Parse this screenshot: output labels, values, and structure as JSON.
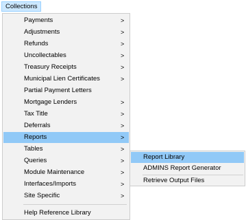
{
  "menubar": {
    "title": "Collections"
  },
  "menu": {
    "items": [
      {
        "label": "Payments",
        "has_submenu": true
      },
      {
        "label": "Adjustments",
        "has_submenu": true
      },
      {
        "label": "Refunds",
        "has_submenu": true
      },
      {
        "label": "Uncollectables",
        "has_submenu": true
      },
      {
        "label": "Treasury Receipts",
        "has_submenu": true
      },
      {
        "label": "Municipal Lien Certificates",
        "has_submenu": true
      },
      {
        "label": "Partial Payment Letters",
        "has_submenu": false
      },
      {
        "label": "Mortgage Lenders",
        "has_submenu": true
      },
      {
        "label": "Tax Title",
        "has_submenu": true
      },
      {
        "label": "Deferrals",
        "has_submenu": true
      },
      {
        "label": "Reports",
        "has_submenu": true,
        "selected": true
      },
      {
        "label": "Tables",
        "has_submenu": true
      },
      {
        "label": "Queries",
        "has_submenu": true
      },
      {
        "label": "Module Maintenance",
        "has_submenu": true
      },
      {
        "label": "Interfaces/Imports",
        "has_submenu": true
      },
      {
        "label": "Site Specific",
        "has_submenu": true
      },
      {
        "label": "Help Reference Library",
        "has_submenu": false
      }
    ],
    "chevron": ">"
  },
  "submenu": {
    "items": [
      {
        "label": "Report Library",
        "selected": true
      },
      {
        "label": "ADMINS Report Generator"
      },
      {
        "label": "Retrieve Output Files"
      }
    ]
  },
  "colors": {
    "highlight": "#91c9f7",
    "menu_bg": "#f2f2f2",
    "menubar_active": "#cce8ff"
  }
}
